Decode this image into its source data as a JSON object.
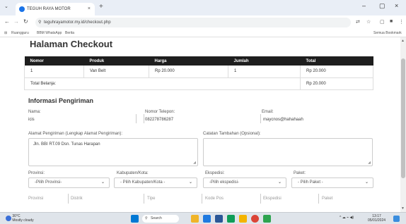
{
  "browser": {
    "tab_title": "TEGUH RAYA MOTOR",
    "tab_close": "×",
    "new_tab": "+",
    "chevron": "⌄",
    "url": "teguhrayamotor.my.id/checkout.php",
    "window_controls": [
      "–",
      "▢",
      "×"
    ],
    "bookmarks": [
      "Ruangguru",
      "BBM WhatsApp",
      "Berita"
    ],
    "all_bookmarks": "Semua Bookmark"
  },
  "page": {
    "title": "Halaman Checkout",
    "table": {
      "headers": [
        "Nomor",
        "Produk",
        "Harga",
        "Jumlah",
        "Total"
      ],
      "rows": [
        [
          "1",
          "Van Belt",
          "Rp 20.000",
          "1",
          "Rp 20.000"
        ]
      ],
      "total_label": "Total Belanja:",
      "total_value": "Rp 20.000"
    },
    "shipping": {
      "heading": "Informasi Pengiriman",
      "name_label": "Nama:",
      "name_value": "icis",
      "phone_label": "Nomor Telepon:",
      "phone_value": "082278786287",
      "email_label": "Email:",
      "email_value": "maycnos@hahahaah",
      "address_label": "Alamat Pengiriman (Lengkap Alamat Pengiriman):",
      "address_value": "Jln. BBI RT.09 Dsn. Tunas Harapan",
      "notes_label": "Catatan Tambahan (Opsional):",
      "province_label": "Provinsi:",
      "province_value": "-Pilih Provinsi-",
      "city_label": "Kabupaten/Kota:",
      "city_value": "- Pilih Kabupaten/Kota -",
      "courier_label": "Ekspedisi:",
      "courier_value": "-Pilih ekspedisi-",
      "package_label": "Paket:",
      "package_value": "- Pilih Paket -",
      "summary_fields": [
        "Provinsi",
        "Distrik",
        "Tipe",
        "Kode Pos",
        "Ekspedisi",
        "Paket"
      ]
    }
  },
  "taskbar": {
    "weather_temp": "30°C",
    "weather_desc": "Mostly cloudy",
    "search": "Search",
    "time": "13:17",
    "date": "05/01/2024"
  }
}
